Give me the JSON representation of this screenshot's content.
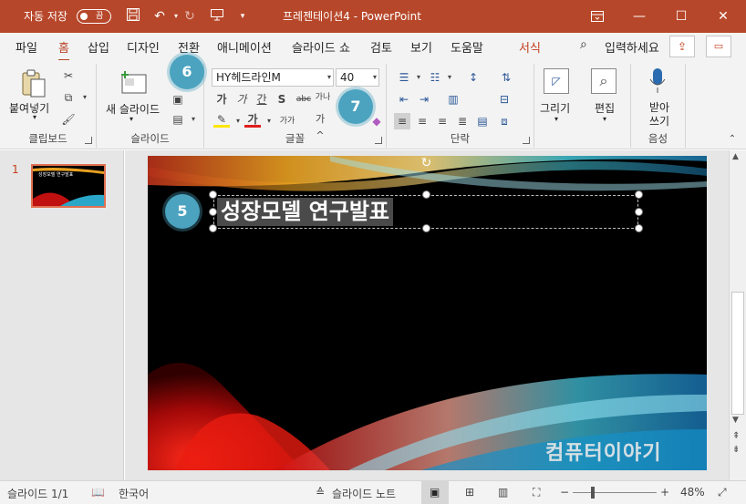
{
  "titlebar": {
    "autosave_label": "자동 저장",
    "autosave_state": "끔",
    "document_title": "프레젠테이션4  -  PowerPoint",
    "icons": [
      "save-icon",
      "undo-icon",
      "redo-icon",
      "present-from-start-icon",
      "customize-qat-icon",
      "ribbon-display-options-icon",
      "minimize-icon",
      "maximize-icon",
      "close-icon"
    ]
  },
  "tabs": [
    {
      "label": "파일"
    },
    {
      "label": "홈"
    },
    {
      "label": "삽입"
    },
    {
      "label": "디자인"
    },
    {
      "label": "전환"
    },
    {
      "label": "애니메이션"
    },
    {
      "label": "슬라이드 쇼"
    },
    {
      "label": "검토"
    },
    {
      "label": "보기"
    },
    {
      "label": "도움말"
    },
    {
      "label": "서식"
    }
  ],
  "tell_me": "입력하세요",
  "ribbon": {
    "clipboard": {
      "paste_label": "붙여넣기",
      "group_label": "클립보드"
    },
    "slides": {
      "new_slide_label": "새 슬라이드",
      "group_label": "슬라이드"
    },
    "font": {
      "font_name": "HY헤드라인M",
      "font_size": "40",
      "group_label": "글꼴",
      "bold": "가",
      "italic": "가",
      "underline": "간",
      "shadow": "S",
      "strike": "abc",
      "spacing": "가나",
      "clear": "가",
      "color": "가",
      "case": "가가",
      "grow": "가^",
      "shrink": "가"
    },
    "paragraph": {
      "group_label": "단락"
    },
    "drawing": {
      "label": "그리기"
    },
    "editing": {
      "label": "편집"
    },
    "voice": {
      "label": "받아 쓰기",
      "group_label": "음성"
    }
  },
  "callouts": {
    "c5": "5",
    "c6": "6",
    "c7": "7"
  },
  "thumbnail": {
    "number": "1",
    "title_text": "성장모델 연구발표"
  },
  "slide": {
    "title_text": "성장모델 연구발표"
  },
  "watermark": "컴퓨터이야기",
  "statusbar": {
    "slide_counter": "슬라이드 1/1",
    "language": "한국어",
    "notes": "슬라이드 노트",
    "zoom": "48%"
  }
}
